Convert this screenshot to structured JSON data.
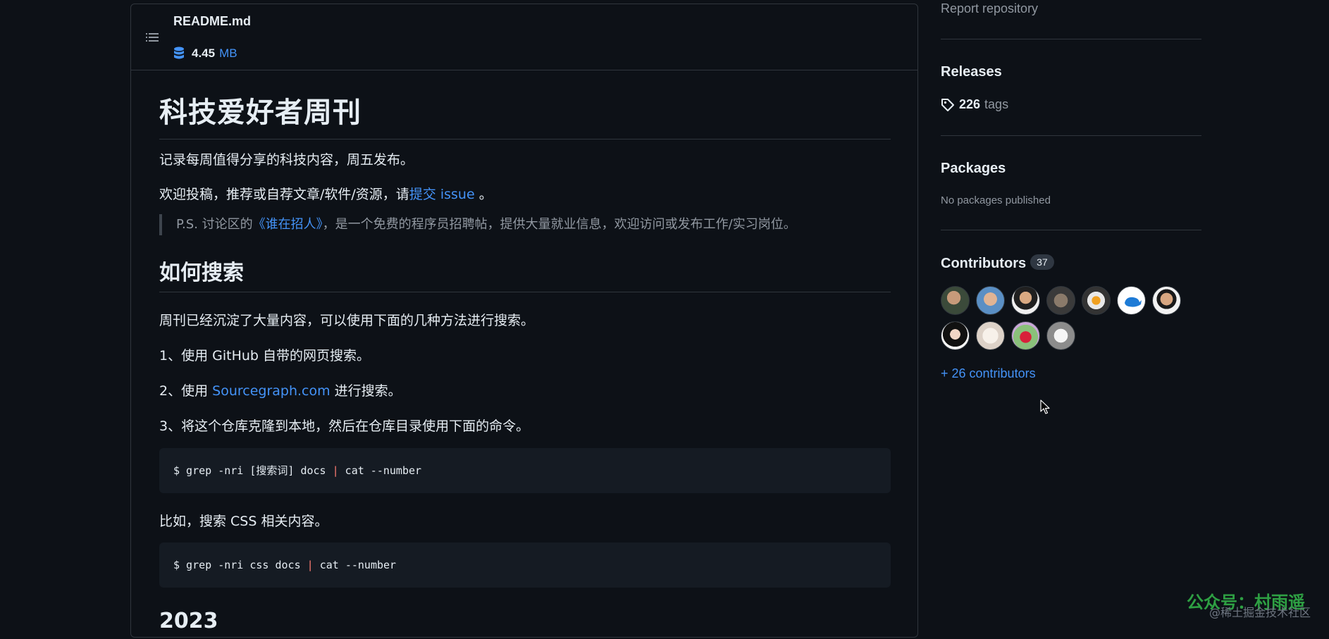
{
  "readme": {
    "file_name": "README.md",
    "size_number": "4.45",
    "size_unit": "MB",
    "title": "科技爱好者周刊",
    "intro": "记录每周值得分享的科技内容，周五发布。",
    "contrib_prefix": "欢迎投稿，推荐或自荐文章/软件/资源，请",
    "contrib_link": "提交 issue",
    "contrib_suffix": " 。",
    "quote_prefix": "P.S. 讨论区的",
    "quote_link": "《谁在招人》",
    "quote_suffix": "，是一个免费的程序员招聘帖，提供大量就业信息，欢迎访问或发布工作/实习岗位。",
    "search_heading": "如何搜索",
    "search_intro": "周刊已经沉淀了大量内容，可以使用下面的几种方法进行搜索。",
    "method1": "1、使用 GitHub 自带的网页搜索。",
    "method2_prefix": "2、使用 ",
    "method2_link": "Sourcegraph.com",
    "method2_suffix": " 进行搜索。",
    "method3": "3、将这个仓库克隆到本地，然后在仓库目录使用下面的命令。",
    "code1_a": "$ grep -nri [搜索词] docs ",
    "code1_pipe": "|",
    "code1_b": " cat --number",
    "example_text": "比如，搜索 CSS 相关内容。",
    "code2_a": "$ grep -nri css docs ",
    "code2_pipe": "|",
    "code2_b": " cat --number",
    "year_heading": "2023"
  },
  "sidebar": {
    "report_link": "Report repository",
    "releases_heading": "Releases",
    "tags_count": "226",
    "tags_label": "tags",
    "packages_heading": "Packages",
    "packages_empty": "No packages published",
    "contributors_heading": "Contributors",
    "contributors_count": "37",
    "more_contributors": "+ 26 contributors"
  },
  "watermark": {
    "account": "公众号：村雨遥",
    "community": "@稀土掘金技术社区"
  },
  "colors": {
    "background": "#0d1117",
    "link": "#4493f8",
    "border": "#30363d",
    "muted": "#9198a1",
    "code_bg": "#151b23",
    "watermark": "#2ea043"
  }
}
